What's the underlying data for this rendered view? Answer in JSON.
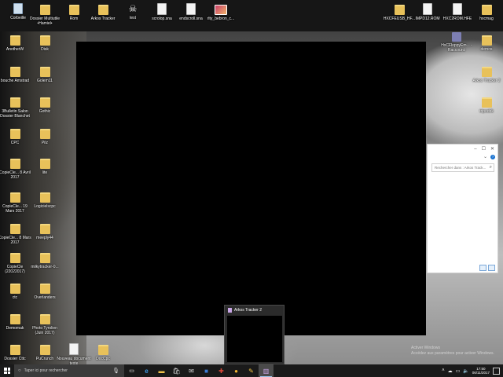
{
  "desktop_icons": [
    {
      "label": "Corbeille",
      "icon": "recycle-bin-icon",
      "kind": "bin"
    },
    {
      "label": "Dossier Multiutile •Hamiel•",
      "icon": "folder-icon",
      "kind": "folder"
    },
    {
      "label": "Rom",
      "icon": "folder-icon",
      "kind": "folder"
    },
    {
      "label": "Arkos Tracker",
      "icon": "folder-icon",
      "kind": "folder"
    },
    {
      "label": "test",
      "icon": "skull-icon",
      "kind": "skull"
    },
    {
      "label": "scrolop.sna",
      "icon": "document-icon",
      "kind": "doc"
    },
    {
      "label": "endscroll.sna",
      "icon": "document-icon",
      "kind": "doc"
    },
    {
      "label": "rlty_bebron_c...",
      "icon": "image-icon",
      "kind": "img"
    },
    {
      "label": "HXCFEUSB_HF...",
      "icon": "folder-icon",
      "kind": "folder"
    },
    {
      "label": "IMPD12.ROM",
      "icon": "document-icon",
      "kind": "doc"
    },
    {
      "label": "HXC2ROM.HFE",
      "icon": "document-icon",
      "kind": "doc"
    },
    {
      "label": "hxcmag",
      "icon": "folder-icon",
      "kind": "folder"
    },
    {
      "label": "AnotherW",
      "icon": "folder-icon",
      "kind": "folder"
    },
    {
      "label": "Disk",
      "icon": "folder-icon",
      "kind": "folder"
    },
    {
      "label": "HxCFloppyEm... - Raccourci",
      "icon": "floppy-emulator-icon",
      "kind": "floppy"
    },
    {
      "label": "demos",
      "icon": "folder-icon",
      "kind": "folder"
    },
    {
      "label": "bouche Amstrad",
      "icon": "folder-icon",
      "kind": "folder"
    },
    {
      "label": "Golem11",
      "icon": "folder-icon",
      "kind": "folder"
    },
    {
      "label": "Arkos Tracker 2",
      "icon": "folder-icon",
      "kind": "folder"
    },
    {
      "label": "3Bulletin Salon Dossier Blanchet",
      "icon": "folder-icon",
      "kind": "folder"
    },
    {
      "label": "Gothic",
      "icon": "folder-icon",
      "kind": "folder"
    },
    {
      "label": "tripodrik",
      "icon": "folder-icon",
      "kind": "folder"
    },
    {
      "label": "CPC",
      "icon": "folder-icon",
      "kind": "folder"
    },
    {
      "label": "Pilz",
      "icon": "folder-icon",
      "kind": "folder"
    },
    {
      "label": "CopieCle... 8 Avril 2017",
      "icon": "folder-icon",
      "kind": "folder"
    },
    {
      "label": "lite",
      "icon": "folder-icon",
      "kind": "folder"
    },
    {
      "label": "CopieCle... 19 Mars 2017",
      "icon": "folder-icon",
      "kind": "folder"
    },
    {
      "label": "Logicielscpc",
      "icon": "folder-icon",
      "kind": "folder"
    },
    {
      "label": "CopieCle... 8 Mars 2017",
      "icon": "folder-icon",
      "kind": "folder"
    },
    {
      "label": "meeply44",
      "icon": "folder-icon",
      "kind": "folder"
    },
    {
      "label": "CopieCle (22022017)",
      "icon": "folder-icon",
      "kind": "folder"
    },
    {
      "label": "milkytracker-0...",
      "icon": "folder-icon",
      "kind": "folder"
    },
    {
      "label": "ctc",
      "icon": "folder-icon",
      "kind": "folder"
    },
    {
      "label": "Overlanders",
      "icon": "folder-icon",
      "kind": "folder"
    },
    {
      "label": "Demomak",
      "icon": "folder-icon",
      "kind": "folder"
    },
    {
      "label": "Photo Tyrolien (Juin 2017)",
      "icon": "folder-icon",
      "kind": "folder"
    },
    {
      "label": "Dossier Cttc",
      "icon": "folder-icon",
      "kind": "folder"
    },
    {
      "label": "PuCrunch",
      "icon": "folder-icon",
      "kind": "folder"
    },
    {
      "label": "Nouveau document texte",
      "icon": "document-icon",
      "kind": "doc"
    },
    {
      "label": "DocCpc",
      "icon": "folder-icon",
      "kind": "folder"
    }
  ],
  "explorer": {
    "search_placeholder": "Rechercher dans : Arkos Track...",
    "minimize": "–",
    "maximize": "☐",
    "close": "✕"
  },
  "preview": {
    "title": "Arkos Tracker 2"
  },
  "watermark": {
    "line1": "Activer Windows",
    "line2": "Accédez aux paramètres pour activer Windows."
  },
  "taskbar": {
    "search_placeholder": "Taper ici pour rechercher",
    "time": "17:50",
    "date": "06/11/2017"
  }
}
